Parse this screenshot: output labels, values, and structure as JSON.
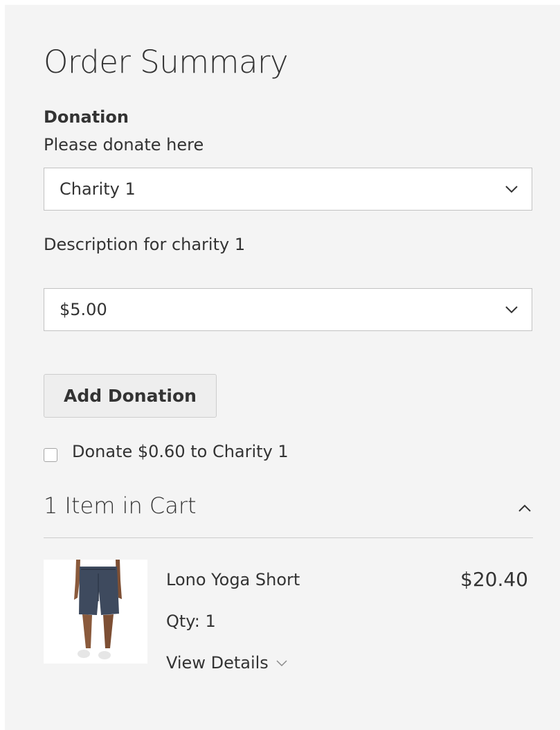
{
  "summary": {
    "title": "Order Summary"
  },
  "donation": {
    "heading": "Donation",
    "subtitle": "Please donate here",
    "charity_select": {
      "value": "Charity 1",
      "icon": "chevron-down-icon"
    },
    "description": "Description for charity 1",
    "amount_select": {
      "value": "$5.00",
      "icon": "chevron-down-icon"
    },
    "add_button": "Add Donation",
    "checkbox": {
      "label": "Donate $0.60 to Charity 1",
      "checked": false
    }
  },
  "cart": {
    "title": "1 Item in Cart",
    "toggle_icon": "chevron-up-icon",
    "items": [
      {
        "name": "Lono Yoga Short",
        "price": "$20.40",
        "qty": "Qty: 1",
        "details_label": "View Details",
        "thumbnail": "product-image"
      }
    ]
  },
  "colors": {
    "panel_bg": "#f4f4f4",
    "text": "#333333",
    "border": "#c2c2c2",
    "button_bg": "#eeeeee"
  }
}
